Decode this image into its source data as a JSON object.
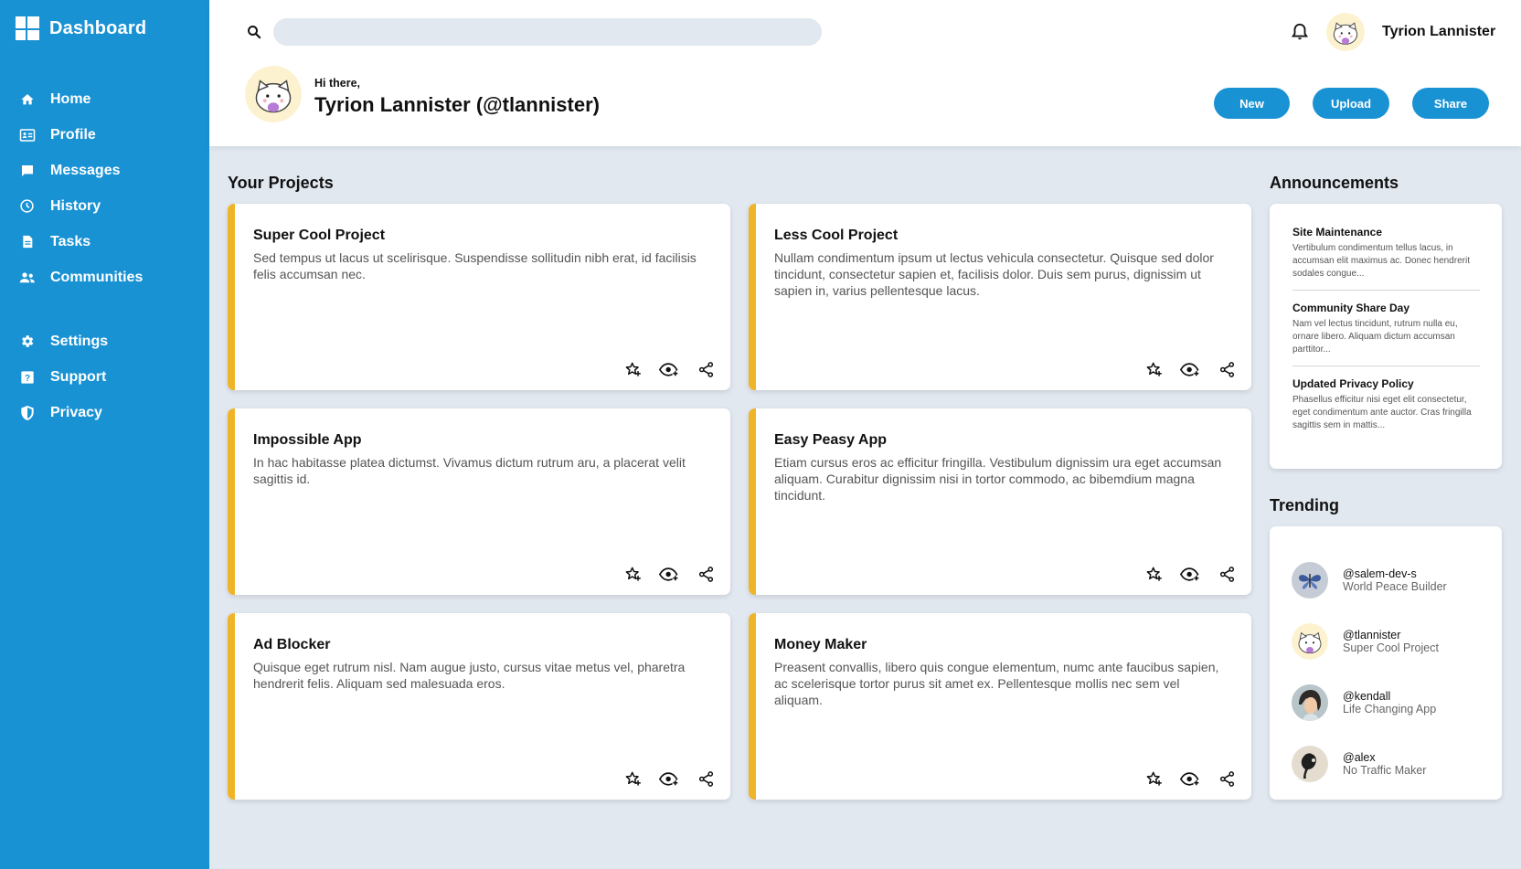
{
  "brand": {
    "title": "Dashboard",
    "icon": "dashboard-grid-icon"
  },
  "nav": {
    "primary": [
      {
        "label": "Home",
        "icon": "home-icon"
      },
      {
        "label": "Profile",
        "icon": "profile-card-icon"
      },
      {
        "label": "Messages",
        "icon": "message-icon"
      },
      {
        "label": "History",
        "icon": "clock-icon"
      },
      {
        "label": "Tasks",
        "icon": "document-icon"
      },
      {
        "label": "Communities",
        "icon": "people-icon"
      }
    ],
    "secondary": [
      {
        "label": "Settings",
        "icon": "gear-icon"
      },
      {
        "label": "Support",
        "icon": "help-icon"
      },
      {
        "label": "Privacy",
        "icon": "shield-icon"
      }
    ]
  },
  "header": {
    "search_placeholder": "",
    "user_name": "Tyrion Lannister",
    "greeting": "Hi there,",
    "full_name": "Tyrion Lannister (@tlannister)",
    "buttons": {
      "new": "New",
      "upload": "Upload",
      "share": "Share"
    }
  },
  "projects": {
    "title": "Your Projects",
    "items": [
      {
        "title": "Super Cool Project",
        "desc": "Sed tempus ut lacus ut scelirisque. Suspendisse sollitudin nibh erat, id facilisis felis accumsan nec."
      },
      {
        "title": "Less Cool Project",
        "desc": "Nullam condimentum ipsum ut lectus vehicula consectetur. Quisque sed dolor tincidunt, consectetur sapien et, facilisis dolor. Duis sem purus, dignissim ut sapien in, varius pellentesque lacus."
      },
      {
        "title": "Impossible App",
        "desc": "In hac habitasse platea dictumst. Vivamus dictum rutrum aru, a placerat velit sagittis id."
      },
      {
        "title": "Easy Peasy App",
        "desc": "Etiam cursus eros ac efficitur fringilla. Vestibulum dignissim ura eget accumsan aliquam. Curabitur dignissim nisi in tortor commodo, ac bibemdium magna tincidunt."
      },
      {
        "title": "Ad Blocker",
        "desc": "Quisque eget rutrum nisl. Nam augue justo, cursus vitae metus vel, pharetra hendrerit felis. Aliquam sed malesuada eros."
      },
      {
        "title": "Money Maker",
        "desc": "Preasent convallis, libero quis congue elementum, numc ante faucibus sapien, ac scelerisque tortor purus sit amet ex. Pellentesque mollis nec sem vel aliquam."
      }
    ],
    "action_icons": [
      "star-add-icon",
      "watch-eye-icon",
      "share-icon"
    ]
  },
  "announcements": {
    "title": "Announcements",
    "items": [
      {
        "title": "Site Maintenance",
        "desc": "Vertibulum condimentum tellus lacus, in accumsan elit maximus ac. Donec hendrerit sodales congue..."
      },
      {
        "title": "Community Share Day",
        "desc": "Nam vel lectus tincidunt, rutrum nulla eu, ornare libero. Aliquam dictum accumsan parttitor..."
      },
      {
        "title": "Updated Privacy Policy",
        "desc": "Phasellus efficitur nisi eget elit consectetur, eget condimentum ante auctor. Cras fringilla sagittis sem in mattis..."
      }
    ]
  },
  "trending": {
    "title": "Trending",
    "items": [
      {
        "handle": "@salem-dev-s",
        "project": "World Peace Builder",
        "avatar": "butterfly-avatar"
      },
      {
        "handle": "@tlannister",
        "project": "Super Cool Project",
        "avatar": "cat-avatar"
      },
      {
        "handle": "@kendall",
        "project": "Life Changing App",
        "avatar": "person-avatar"
      },
      {
        "handle": "@alex",
        "project": "No Traffic Maker",
        "avatar": "sketch-avatar"
      }
    ]
  },
  "colors": {
    "primary": "#1992d4",
    "accent": "#f0b429",
    "background": "#e2e8f0"
  }
}
